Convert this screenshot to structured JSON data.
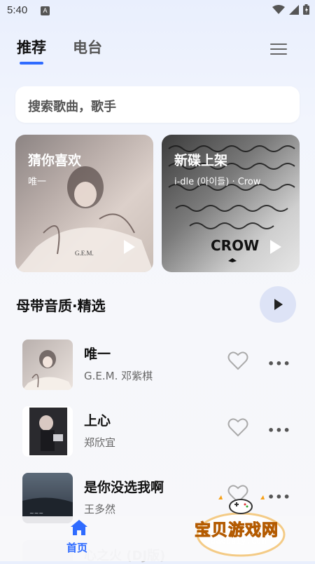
{
  "status_bar": {
    "time": "5:40",
    "notification_icon": "A"
  },
  "tabs": [
    {
      "label": "推荐",
      "active": true
    },
    {
      "label": "电台",
      "active": false
    }
  ],
  "search": {
    "placeholder": "搜索歌曲，歌手"
  },
  "cards": [
    {
      "title": "猜你喜欢",
      "subtitle": "唯一"
    },
    {
      "title": "新碟上架",
      "subtitle": "i-dle (아이들) · Crow"
    }
  ],
  "section": {
    "title": "母带音质·精选"
  },
  "songs": [
    {
      "title": "唯一",
      "artist": "G.E.M. 邓紫棋"
    },
    {
      "title": "上心",
      "artist": "郑欣宜"
    },
    {
      "title": "是你没选我啊",
      "artist": "王多然"
    }
  ],
  "partial_song": {
    "title": "心之火 (DJ版)"
  },
  "bottom_nav": {
    "home_label": "首页"
  },
  "watermark": {
    "text": "宝贝游戏网",
    "url": "baobeiy.com"
  },
  "colors": {
    "accent": "#2f6bff",
    "play_bg": "#dde3f6"
  }
}
